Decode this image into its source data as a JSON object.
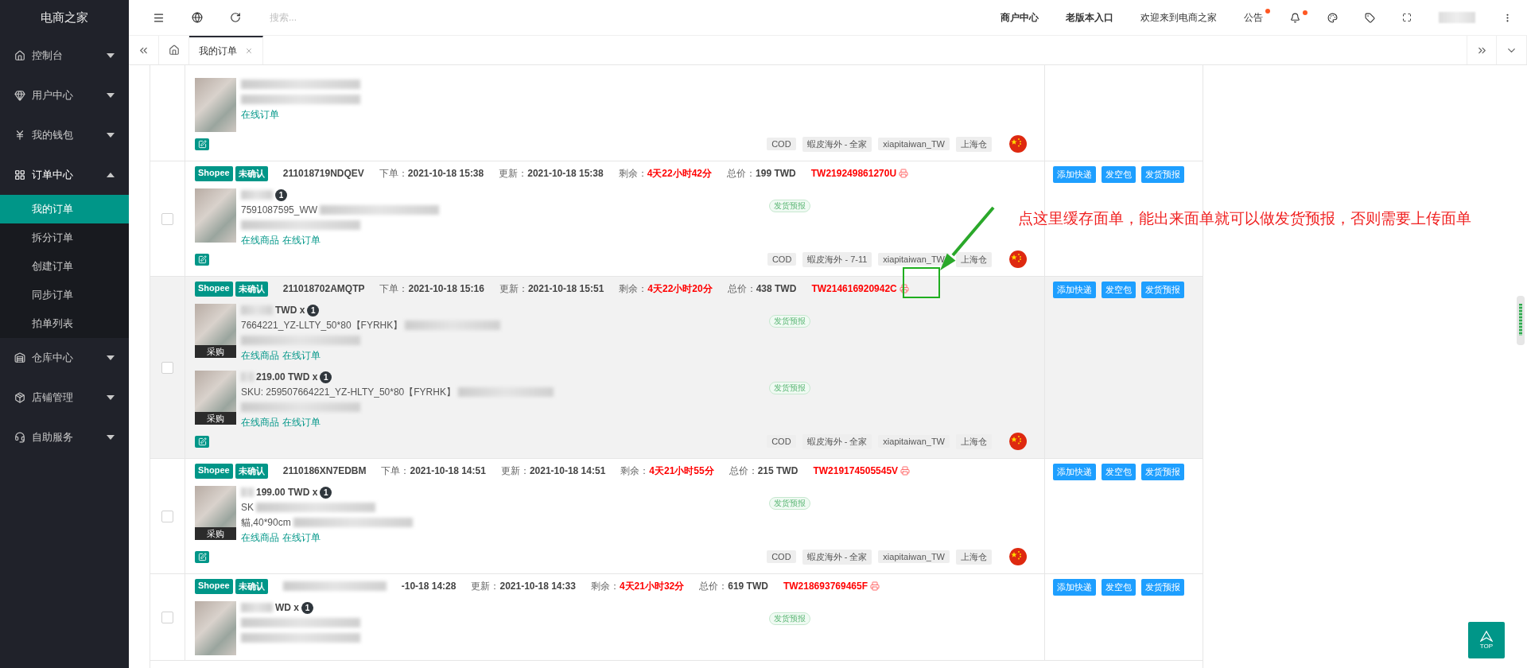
{
  "sidebar": {
    "logo": "电商之家",
    "items": [
      {
        "label": "控制台",
        "expanded": false
      },
      {
        "label": "用户中心",
        "expanded": false
      },
      {
        "label": "我的钱包",
        "expanded": false
      },
      {
        "label": "订单中心",
        "expanded": true,
        "children": [
          {
            "label": "我的订单",
            "selected": true
          },
          {
            "label": "拆分订单",
            "selected": false
          },
          {
            "label": "创建订单",
            "selected": false
          },
          {
            "label": "同步订单",
            "selected": false
          },
          {
            "label": "拍单列表",
            "selected": false
          }
        ]
      },
      {
        "label": "仓库中心",
        "expanded": false
      },
      {
        "label": "店铺管理",
        "expanded": false
      },
      {
        "label": "自助服务",
        "expanded": false
      }
    ]
  },
  "topbar": {
    "search": {
      "placeholder": "搜索..."
    },
    "links": [
      {
        "label": "商户中心",
        "bold": true
      },
      {
        "label": "老版本入口",
        "bold": true
      },
      {
        "label": "欢迎来到电商之家",
        "bold": false
      }
    ],
    "notice": {
      "label": "公告",
      "unread": true
    },
    "bell_unread": true
  },
  "tabs": [
    {
      "label": "我的订单",
      "selected": true
    }
  ],
  "orders": [
    {
      "highlighted": false,
      "items": [
        {
          "links": [
            "在线订单"
          ]
        }
      ],
      "tags": [
        "COD",
        "蝦皮海外 - 全家",
        "xiapitaiwan_TW",
        "上海仓"
      ]
    },
    {
      "highlighted": false,
      "checked": false,
      "platform": "Shopee",
      "status": "未确认",
      "order_no": "211018719NDQEV",
      "fields": [
        {
          "label": "下单：",
          "value": "2021-10-18 15:38",
          "kind": "plain"
        },
        {
          "label": "更新：",
          "value": "2021-10-18 15:38",
          "kind": "plain"
        },
        {
          "label": "剩余：",
          "value": "4天22小时42分",
          "kind": "alert"
        },
        {
          "label": "总价：",
          "value": "199 TWD",
          "kind": "plain"
        }
      ],
      "tracking": "TW219249861270U",
      "items": [
        {
          "qty": "1",
          "sku": "7591087595_WW",
          "links": [
            "在线商品",
            "在线订单"
          ],
          "forecast": "发货预报"
        }
      ],
      "tags": [
        "COD",
        "蝦皮海外 - 7-11",
        "xiapitaiwan_TW",
        "上海仓"
      ],
      "actions": [
        "添加快递",
        "发空包",
        "发货预报"
      ]
    },
    {
      "highlighted": true,
      "checked": false,
      "platform": "Shopee",
      "status": "未确认",
      "order_no": "211018702AMQTP",
      "fields": [
        {
          "label": "下单：",
          "value": "2021-10-18 15:16",
          "kind": "plain"
        },
        {
          "label": "更新：",
          "value": "2021-10-18 15:51",
          "kind": "plain"
        },
        {
          "label": "剩余：",
          "value": "4天22小时20分",
          "kind": "alert"
        },
        {
          "label": "总价：",
          "value": "438 TWD",
          "kind": "plain"
        }
      ],
      "tracking": "TW214616920942C",
      "items": [
        {
          "price": "TWD x",
          "qty": "1",
          "sku": "7664221_YZ-LLTY_50*80【FYRHK】",
          "badge": "采购",
          "links": [
            "在线商品",
            "在线订单"
          ],
          "forecast": "发货预报"
        },
        {
          "price": "219.00 TWD x",
          "qty": "1",
          "sku": "SKU: 259507664221_YZ-HLTY_50*80【FYRHK】",
          "badge": "采购",
          "links": [
            "在线商品",
            "在线订单"
          ],
          "forecast": "发货预报"
        }
      ],
      "tags": [
        "COD",
        "蝦皮海外 - 全家",
        "xiapitaiwan_TW",
        "上海仓"
      ],
      "actions": [
        "添加快递",
        "发空包",
        "发货预报"
      ]
    },
    {
      "highlighted": false,
      "checked": false,
      "platform": "Shopee",
      "status": "未确认",
      "order_no": "2110186XN7EDBM",
      "fields": [
        {
          "label": "下单：",
          "value": "2021-10-18 14:51",
          "kind": "plain"
        },
        {
          "label": "更新：",
          "value": "2021-10-18 14:51",
          "kind": "plain"
        },
        {
          "label": "剩余：",
          "value": "4天21小时55分",
          "kind": "alert"
        },
        {
          "label": "总价：",
          "value": "215 TWD",
          "kind": "plain"
        }
      ],
      "tracking": "TW219174505545V",
      "items": [
        {
          "price": "199.00 TWD x",
          "qty": "1",
          "sku": "SK",
          "extra": "貓,40*90cm",
          "badge": "采购",
          "links": [
            "在线商品",
            "在线订单"
          ],
          "forecast": "发货预报"
        }
      ],
      "tags": [
        "COD",
        "蝦皮海外 - 全家",
        "xiapitaiwan_TW",
        "上海仓"
      ],
      "actions": [
        "添加快递",
        "发空包",
        "发货预报"
      ]
    },
    {
      "highlighted": false,
      "checked": false,
      "platform": "Shopee",
      "status": "未确认",
      "fields": [
        {
          "value": "-10-18 14:28",
          "kind": "plain"
        },
        {
          "label": "更新：",
          "value": "2021-10-18 14:33",
          "kind": "plain"
        },
        {
          "label": "剩余：",
          "value": "4天21小时32分",
          "kind": "alert"
        },
        {
          "label": "总价：",
          "value": "619 TWD",
          "kind": "plain"
        }
      ],
      "tracking": "TW218693769465F",
      "items": [
        {
          "price": "WD x",
          "qty": "1",
          "forecast": "发货预报"
        }
      ],
      "actions": [
        "添加快递",
        "发空包",
        "发货预报"
      ]
    }
  ],
  "annotation": {
    "text": "点这里缓存面单，能出来面单就可以做发货预报，否则需要上传面单"
  },
  "back_to_top": "TOP"
}
